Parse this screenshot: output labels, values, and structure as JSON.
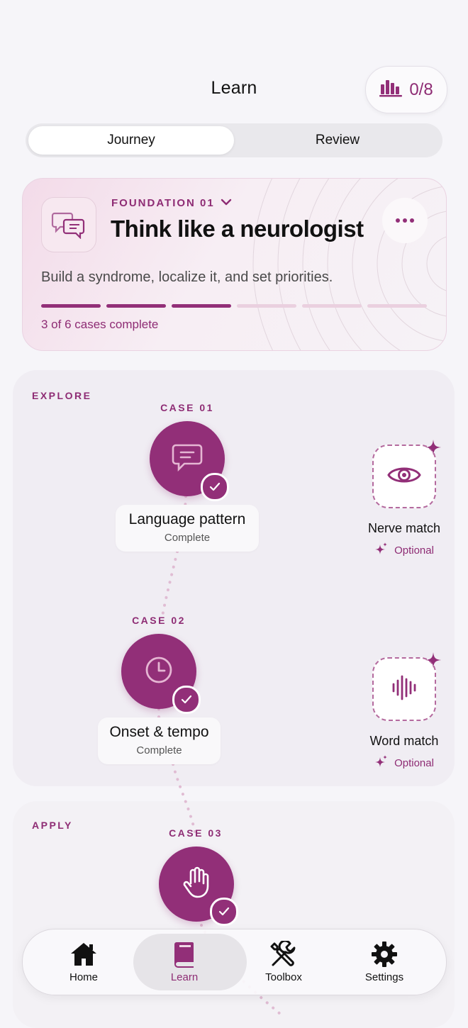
{
  "header": {
    "title": "Learn",
    "score": "0/8"
  },
  "segmented": {
    "tabs": [
      "Journey",
      "Review"
    ],
    "active": "Journey"
  },
  "foundation": {
    "kicker": "FOUNDATION 01",
    "title": "Think like a neurologist",
    "description": "Build a syndrome, localize it, and set priorities.",
    "progress_text": "3 of 6 cases complete",
    "completed": 3,
    "total": 6
  },
  "explore": {
    "label": "EXPLORE",
    "cases": [
      {
        "number": "CASE 01",
        "title": "Language pattern",
        "status": "Complete",
        "icon": "speech-bubble-icon"
      },
      {
        "number": "CASE 02",
        "title": "Onset & tempo",
        "status": "Complete",
        "icon": "clock-icon"
      }
    ],
    "optional": [
      {
        "title": "Nerve match",
        "tag": "Optional",
        "icon": "eye-icon"
      },
      {
        "title": "Word match",
        "tag": "Optional",
        "icon": "waveform-icon"
      }
    ]
  },
  "apply": {
    "label": "APPLY",
    "cases": [
      {
        "number": "CASE 03",
        "icon": "hand-icon"
      }
    ]
  },
  "tabbar": {
    "items": [
      {
        "label": "Home",
        "icon": "home-icon"
      },
      {
        "label": "Learn",
        "icon": "book-icon"
      },
      {
        "label": "Toolbox",
        "icon": "tools-icon"
      },
      {
        "label": "Settings",
        "icon": "gear-icon"
      }
    ],
    "active": "Learn"
  },
  "colors": {
    "accent": "#922f78",
    "background": "#f6f5f9",
    "section": "#f0edf3"
  }
}
